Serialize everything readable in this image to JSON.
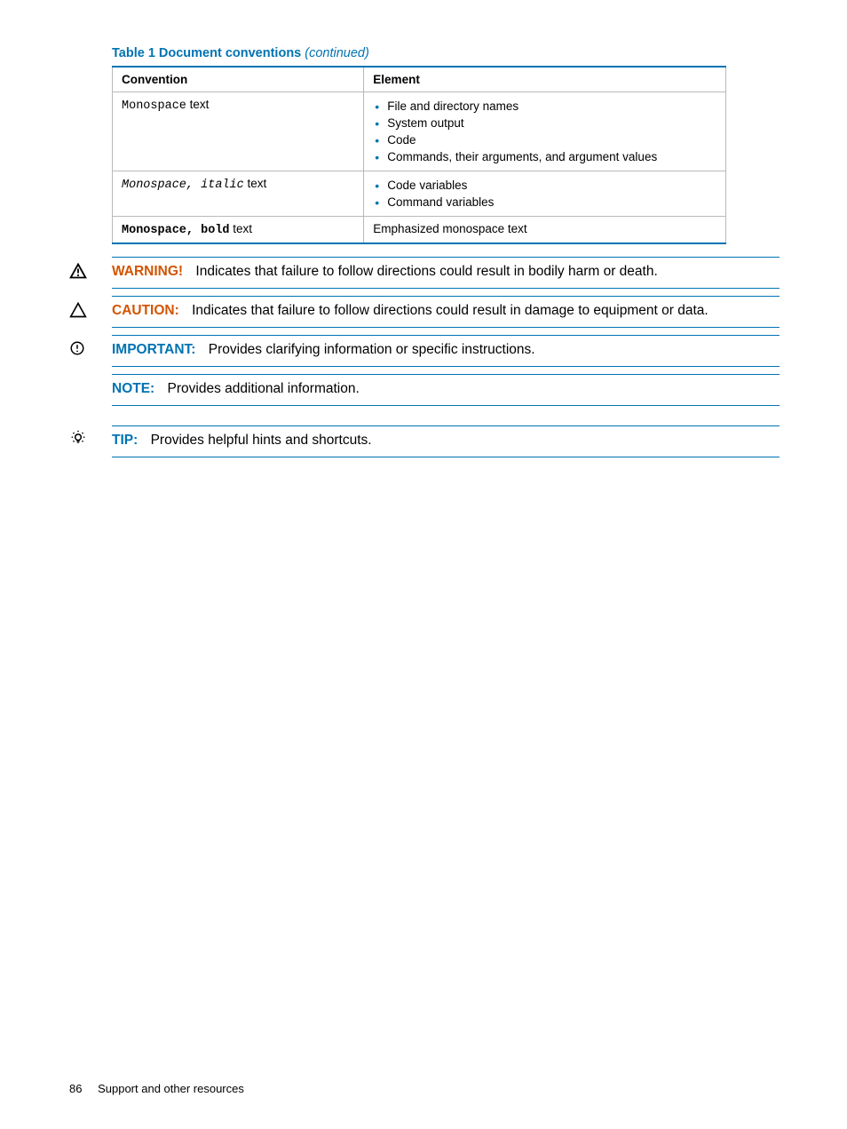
{
  "table": {
    "caption_bold": "Table 1 Document conventions",
    "caption_italic": "(continued)",
    "headers": {
      "convention": "Convention",
      "element": "Element"
    },
    "rows": [
      {
        "conv_mono": "Monospace",
        "conv_plain": " text",
        "items": [
          "File and directory names",
          "System output",
          "Code",
          "Commands, their arguments, and argument values"
        ]
      },
      {
        "conv_mono_italic": "Monospace, italic",
        "conv_plain": " text",
        "items": [
          "Code variables",
          "Command variables"
        ]
      },
      {
        "conv_mono_bold": "Monospace, bold",
        "conv_plain": " text",
        "plain_element": "Emphasized monospace text"
      }
    ]
  },
  "admonitions": {
    "warning": {
      "label": "WARNING!",
      "text": "Indicates that failure to follow directions could result in bodily harm or death."
    },
    "caution": {
      "label": "CAUTION:",
      "text": "Indicates that failure to follow directions could result in damage to equipment or data."
    },
    "important": {
      "label": "IMPORTANT:",
      "text": "Provides clarifying information or specific instructions."
    },
    "note": {
      "label": "NOTE:",
      "text": "Provides additional information."
    },
    "tip": {
      "label": "TIP:",
      "text": "Provides helpful hints and shortcuts."
    }
  },
  "footer": {
    "page_number": "86",
    "section": "Support and other resources"
  }
}
